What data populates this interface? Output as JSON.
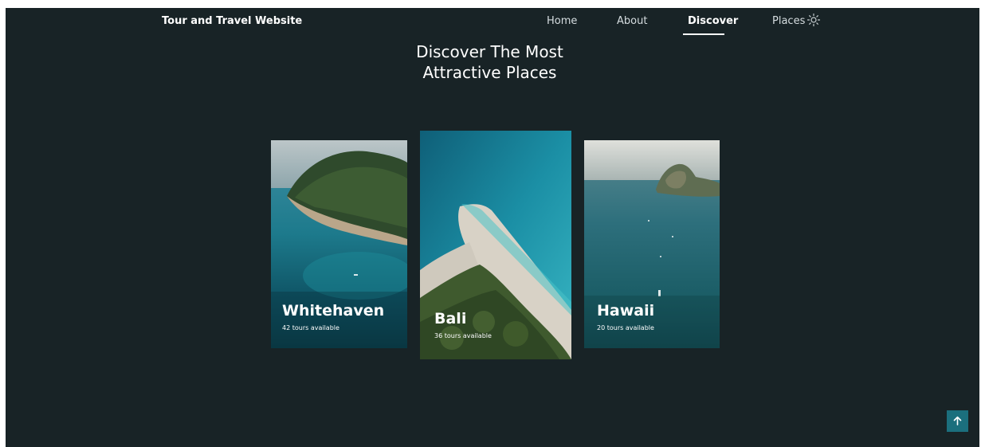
{
  "header": {
    "brand": "Tour and Travel Website",
    "nav": [
      {
        "label": "Home"
      },
      {
        "label": "About"
      },
      {
        "label": "Discover",
        "active": true
      },
      {
        "label": "Places"
      }
    ],
    "theme_toggle_icon": "sun-icon"
  },
  "section": {
    "title_line1": "Discover The Most",
    "title_line2": "Attractive Places"
  },
  "cards": [
    {
      "name": "Whitehaven",
      "subtitle": "42 tours available"
    },
    {
      "name": "Bali",
      "subtitle": "36 tours available"
    },
    {
      "name": "Hawaii",
      "subtitle": "20 tours available"
    }
  ],
  "scroll_up_icon": "arrow-up-icon",
  "colors": {
    "background": "#182326",
    "accent": "#1b6f7d",
    "text": "#ffffff"
  }
}
